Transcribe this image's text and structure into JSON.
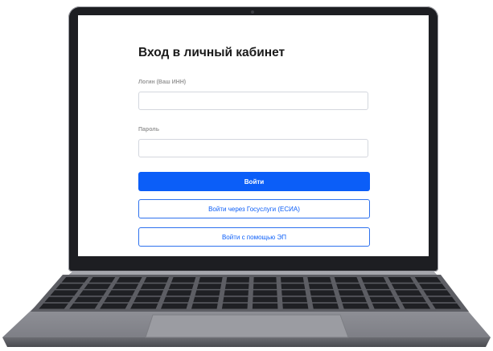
{
  "login": {
    "title": "Вход в личный кабинет",
    "login_label": "Логин (Ваш ИНН)",
    "login_value": "",
    "password_label": "Пароль",
    "password_value": "",
    "submit_label": "Войти",
    "gosuslugi_label": "Войти через Госуслуги (ЕСИА)",
    "ep_label": "Войти с помощью ЭП"
  },
  "colors": {
    "primary": "#0b5ef8",
    "laptop_body": "#8f9097",
    "bezel": "#1d1e22"
  }
}
